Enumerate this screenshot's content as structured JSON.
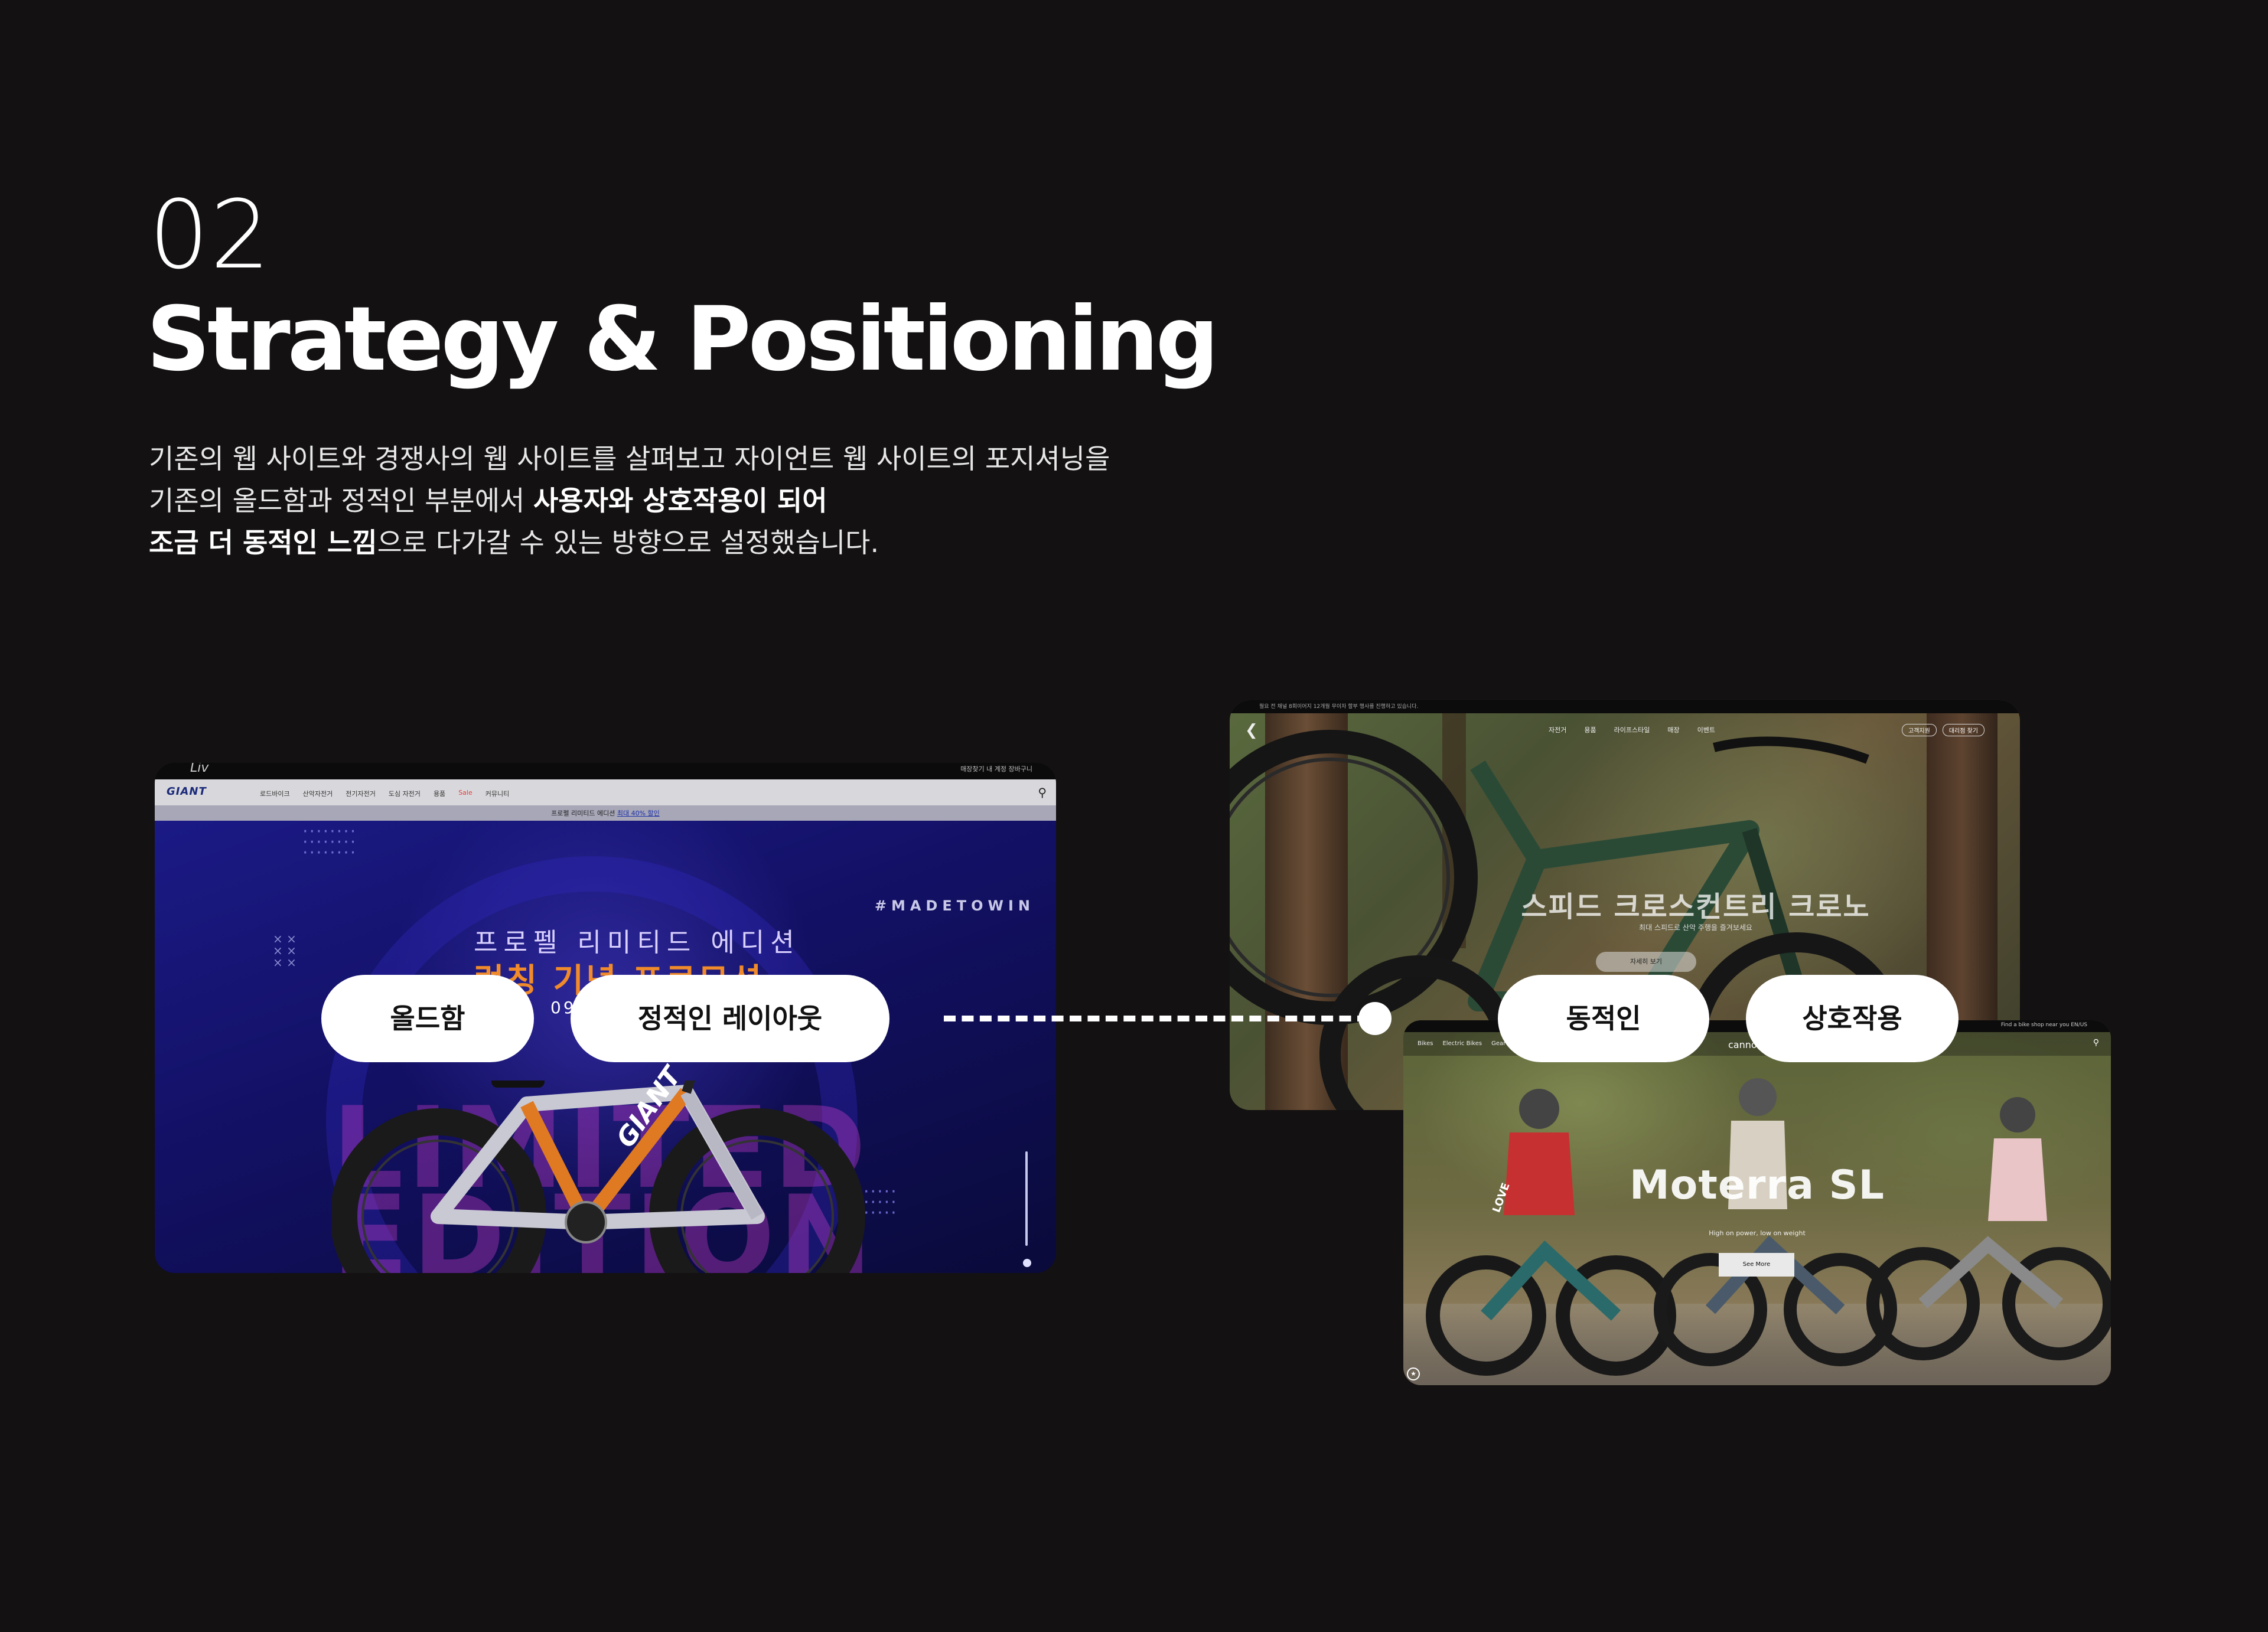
{
  "header": {
    "section_number": "02",
    "title": "Strategy & Positioning",
    "desc_line1": "기존의 웹 사이트와 경쟁사의 웹 사이트를 살펴보고 자이언트 웹 사이트의 포지셔닝을",
    "desc_line2_normal": "기존의 올드함과 정적인 부분에서 ",
    "desc_line2_bold": "사용자와 상호작용이 되어",
    "desc_line3_bold": "조금 더 동적인 느낌",
    "desc_line3_normal": "으로 다가갈 수 있는 방향으로 설정했습니다."
  },
  "giant_site": {
    "brand_small": "Liv",
    "logo": "GIANT",
    "top_menu": "매장찾기  내 계정  장바구니",
    "menu": [
      "로드바이크",
      "산악자전거",
      "전기자전거",
      "도심 자전거",
      "용품",
      "Sale",
      "커뮤니티"
    ],
    "promo": "프로펠 리미티드 에디션 ",
    "promo_link": "최대 40% 할인",
    "hashtag": "#MADETOWIN",
    "hero_title1": "프로펠 리미티드 에디션",
    "hero_title2": "런칭 기념 프로모션",
    "hero_date": "09.25 - 10.31",
    "bg_text": "LIMITED EDITION",
    "frame_text": "GIANT"
  },
  "cannondale_site_1": {
    "top_bar": "월요 전 채널 8회이어지 12개월 무이자 할부 행사를 진행하고 있습니다.",
    "menu": [
      "자전거",
      "용품",
      "라이프스타일",
      "매장",
      "이벤트"
    ],
    "buttons": [
      "고객지원",
      "대리점 찾기"
    ],
    "hero_title": "스피드 크로스컨트리 크로노",
    "hero_sub": "최대 스피드로 산악 주행을 즐겨보세요",
    "cta": "자세히 보기"
  },
  "cannondale_site_2": {
    "top_bar": "Find a bike shop near you   EN/US",
    "menu": [
      "Bikes",
      "Electric Bikes",
      "Gear"
    ],
    "logo": "cannondale",
    "hero_title": "Moterra SL",
    "hero_sub": "High on power, low on weight",
    "cta": "See More",
    "jersey_text": "LOVE"
  },
  "tags": {
    "old": "올드함",
    "static": "정적인 레이아웃",
    "dynamic": "동적인",
    "interaction": "상호작용"
  },
  "colors": {
    "background": "#131112",
    "giant_navy": "#121063",
    "promo_orange": "#f08a2a",
    "pill": "#ffffff"
  }
}
